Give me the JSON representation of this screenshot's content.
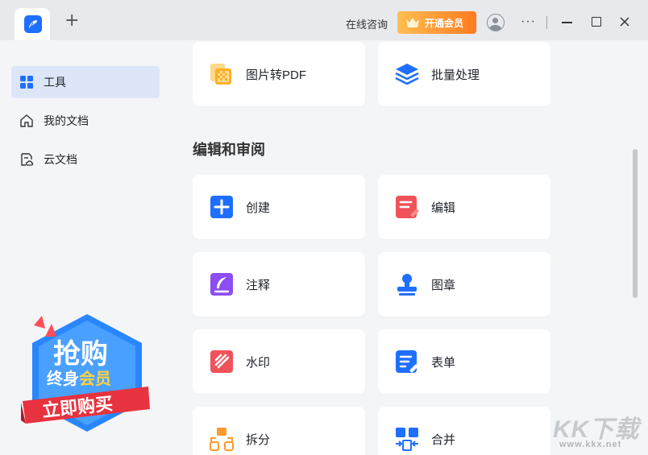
{
  "titlebar": {
    "add_tab_label": "+",
    "consult_label": "在线咨询",
    "vip_label": "开通会员",
    "more_label": "···"
  },
  "sidebar": {
    "items": [
      {
        "label": "工具",
        "icon": "grid-icon",
        "active": true
      },
      {
        "label": "我的文档",
        "icon": "home-icon",
        "active": false
      },
      {
        "label": "云文档",
        "icon": "cloud-doc-icon",
        "active": false
      }
    ]
  },
  "promo": {
    "line1": "抢购",
    "line2a": "终身",
    "line2b": "会员",
    "cta": "立即购买"
  },
  "main": {
    "top_cards": [
      {
        "label": "图片转PDF",
        "icon": "image-to-pdf-icon"
      },
      {
        "label": "批量处理",
        "icon": "layers-icon"
      }
    ],
    "section_title": "编辑和审阅",
    "tools": [
      {
        "label": "创建",
        "icon": "plus-icon"
      },
      {
        "label": "编辑",
        "icon": "edit-doc-icon"
      },
      {
        "label": "注释",
        "icon": "quill-icon"
      },
      {
        "label": "图章",
        "icon": "stamp-icon"
      },
      {
        "label": "水印",
        "icon": "watermark-icon"
      },
      {
        "label": "表单",
        "icon": "form-icon"
      },
      {
        "label": "拆分",
        "icon": "split-icon"
      },
      {
        "label": "合并",
        "icon": "merge-icon"
      }
    ]
  },
  "watermark": {
    "brand": "KK下载",
    "url": "www.kkx.net"
  },
  "colors": {
    "accent_blue": "#1f6fff",
    "vip_orange": "#ff7a1f",
    "edit_red": "#f0525a",
    "annotate_purple": "#8c4df2",
    "split_orange": "#ff9a2e"
  }
}
